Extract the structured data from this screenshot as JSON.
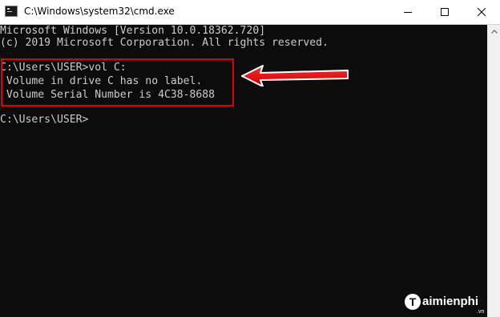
{
  "window": {
    "title": "C:\\Windows\\system32\\cmd.exe",
    "icon": "console-icon",
    "controls": [
      "minimize-icon",
      "maximize-icon",
      "close-icon"
    ]
  },
  "console": {
    "lines": [
      "Microsoft Windows [Version 10.0.18362.720]",
      "(c) 2019 Microsoft Corporation. All rights reserved.",
      "",
      "C:\\Users\\USER>vol C:",
      " Volume in drive C has no label.",
      " Volume Serial Number is 4C38-8688",
      "",
      "C:\\Users\\USER>"
    ],
    "text_color": "#cccccc",
    "background": "#0c0c0c"
  },
  "annotation": {
    "highlight_color": "#e00000",
    "arrow_icon": "arrow-left-icon"
  },
  "watermark": {
    "logo_letter": "T",
    "text": "aimienphi",
    "sub": ".vn"
  }
}
